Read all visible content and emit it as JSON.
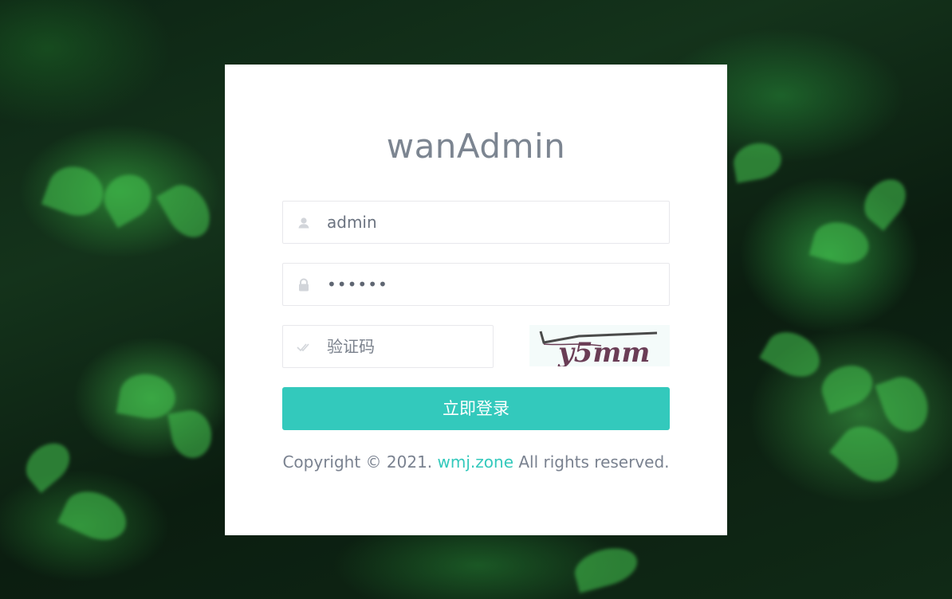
{
  "app": {
    "title": "wanAdmin"
  },
  "form": {
    "username": {
      "value": "admin",
      "icon": "user-icon"
    },
    "password": {
      "value": "••••••",
      "icon": "lock-icon"
    },
    "captcha": {
      "placeholder": "验证码",
      "icon": "check-icon",
      "image_text": "y5mm"
    },
    "submit_label": "立即登录"
  },
  "footer": {
    "prefix": "Copyright © 2021. ",
    "link_text": "wmj.zone",
    "suffix": " All rights reserved."
  },
  "colors": {
    "accent": "#33c9bc",
    "text": "#7c8591",
    "card": "#ffffff"
  }
}
